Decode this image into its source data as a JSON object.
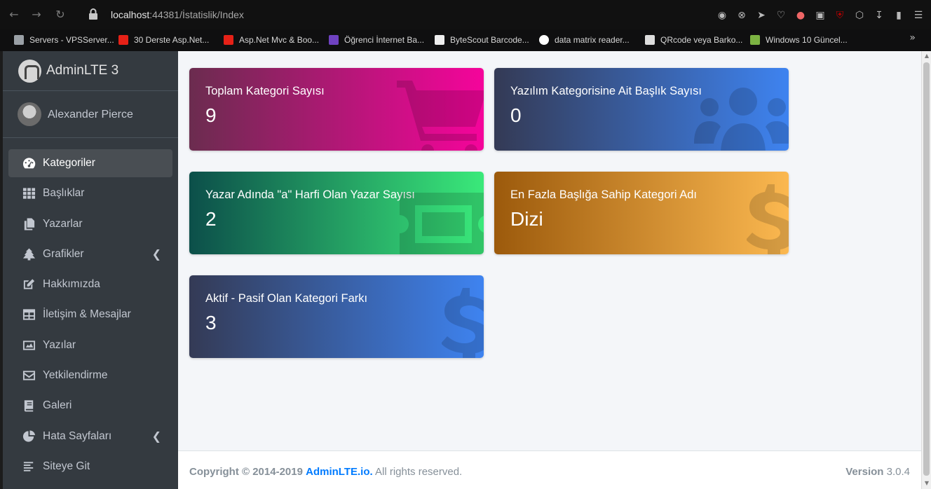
{
  "browser": {
    "url_host": "localhost",
    "url_rest": ":44381/İstatislik/Index",
    "bookmarks": [
      {
        "label": "Servers - VPSServer...",
        "color": "#9aa0a6"
      },
      {
        "label": "30 Derste Asp.Net...",
        "color": "#e62117"
      },
      {
        "label": "Asp.Net Mvc & Boo...",
        "color": "#e62117"
      },
      {
        "label": "Öğrenci İnternet Ba...",
        "color": "#6f42c1"
      },
      {
        "label": "ByteScout Barcode...",
        "color": "#eeeeee"
      },
      {
        "label": "data matrix reader...",
        "color": "#ffffff"
      },
      {
        "label": "QRcode veya Barko...",
        "color": "#dddddd"
      },
      {
        "label": "Windows 10 Güncel...",
        "color": "#7cb342"
      }
    ]
  },
  "sidebar": {
    "brand": "AdminLTE 3",
    "user": "Alexander Pierce",
    "items": [
      {
        "label": "Kategoriler",
        "icon": "tachometer-icon",
        "active": true,
        "caret": false
      },
      {
        "label": "Başlıklar",
        "icon": "th-icon",
        "active": false,
        "caret": false
      },
      {
        "label": "Yazarlar",
        "icon": "copy-icon",
        "active": false,
        "caret": false
      },
      {
        "label": "Grafikler",
        "icon": "tree-icon",
        "active": false,
        "caret": true
      },
      {
        "label": "Hakkımızda",
        "icon": "edit-icon",
        "active": false,
        "caret": false
      },
      {
        "label": "İletişim & Mesajlar",
        "icon": "table-icon",
        "active": false,
        "caret": false
      },
      {
        "label": "Yazılar",
        "icon": "image-icon",
        "active": false,
        "caret": false
      },
      {
        "label": "Yetkilendirme",
        "icon": "envelope-icon",
        "active": false,
        "caret": false
      },
      {
        "label": "Galeri",
        "icon": "book-icon",
        "active": false,
        "caret": false
      },
      {
        "label": "Hata Sayfaları",
        "icon": "pie-chart-icon",
        "active": false,
        "caret": true
      },
      {
        "label": "Siteye Git",
        "icon": "align-left-icon",
        "active": false,
        "caret": false
      }
    ]
  },
  "cards": [
    {
      "title": "Toplam Kategori Sayısı",
      "value": "9",
      "icon": "shopping-cart-icon",
      "gradient": [
        "#6b2c4f",
        "#f5049b"
      ]
    },
    {
      "title": "Yazılım Kategorisine Ait Başlık Sayısı",
      "value": "0",
      "icon": "users-icon",
      "gradient": [
        "#343a55",
        "#3e83f0"
      ]
    },
    {
      "title": "Yazar Adında \"a\" Harfi Olan Yazar Sayısı",
      "value": "2",
      "icon": "ticket-icon",
      "gradient": [
        "#0c4f4a",
        "#3ae97a"
      ]
    },
    {
      "title": "En Fazla Başlığa Sahip Kategori Adı",
      "value": "Dizi",
      "icon": "dollar-icon",
      "gradient": [
        "#9c5a0c",
        "#fbb850"
      ]
    },
    {
      "title": "Aktif - Pasif Olan Kategori Farkı",
      "value": "3",
      "icon": "dollar-icon",
      "gradient": [
        "#343a55",
        "#3e83f0"
      ]
    }
  ],
  "footer": {
    "copyright": "Copyright © 2014-2019",
    "link": "AdminLTE.io.",
    "rights": "All rights reserved.",
    "version_label": "Version",
    "version": "3.0.4"
  }
}
